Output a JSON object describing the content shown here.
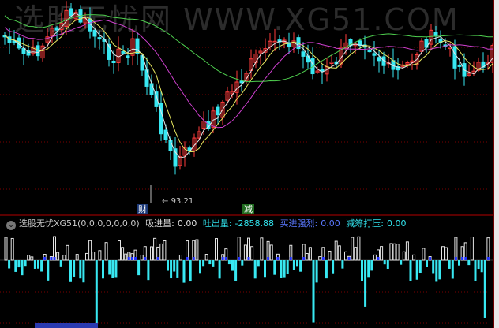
{
  "watermark_text": "选股无忧网 WWW.XG51.COM",
  "low_price_label": "93.21",
  "markers": {
    "cai": "财",
    "jian": "减"
  },
  "indicator": {
    "name": "选股无忧XG51(0,0,0,0,0,0,0)",
    "xijin_label": "吸进量:",
    "xijin_value": "0.00",
    "tuchu_label": "吐出量:",
    "tuchu_value": "-2858.88",
    "mairu_label": "买进强烈:",
    "mairu_value": "0.00",
    "jianchou_label": "减筹打压:",
    "jianchou_value": "0.00"
  },
  "colors": {
    "up": "#ff3b3b",
    "down": "#38e8f2",
    "ma_yellow": "#e8e860",
    "ma_white": "#e6e6e6",
    "ma_magenta": "#d040d0",
    "ma_green": "#4fd04f",
    "grid": "#7a0000",
    "blue_bar": "#2030ff"
  }
}
